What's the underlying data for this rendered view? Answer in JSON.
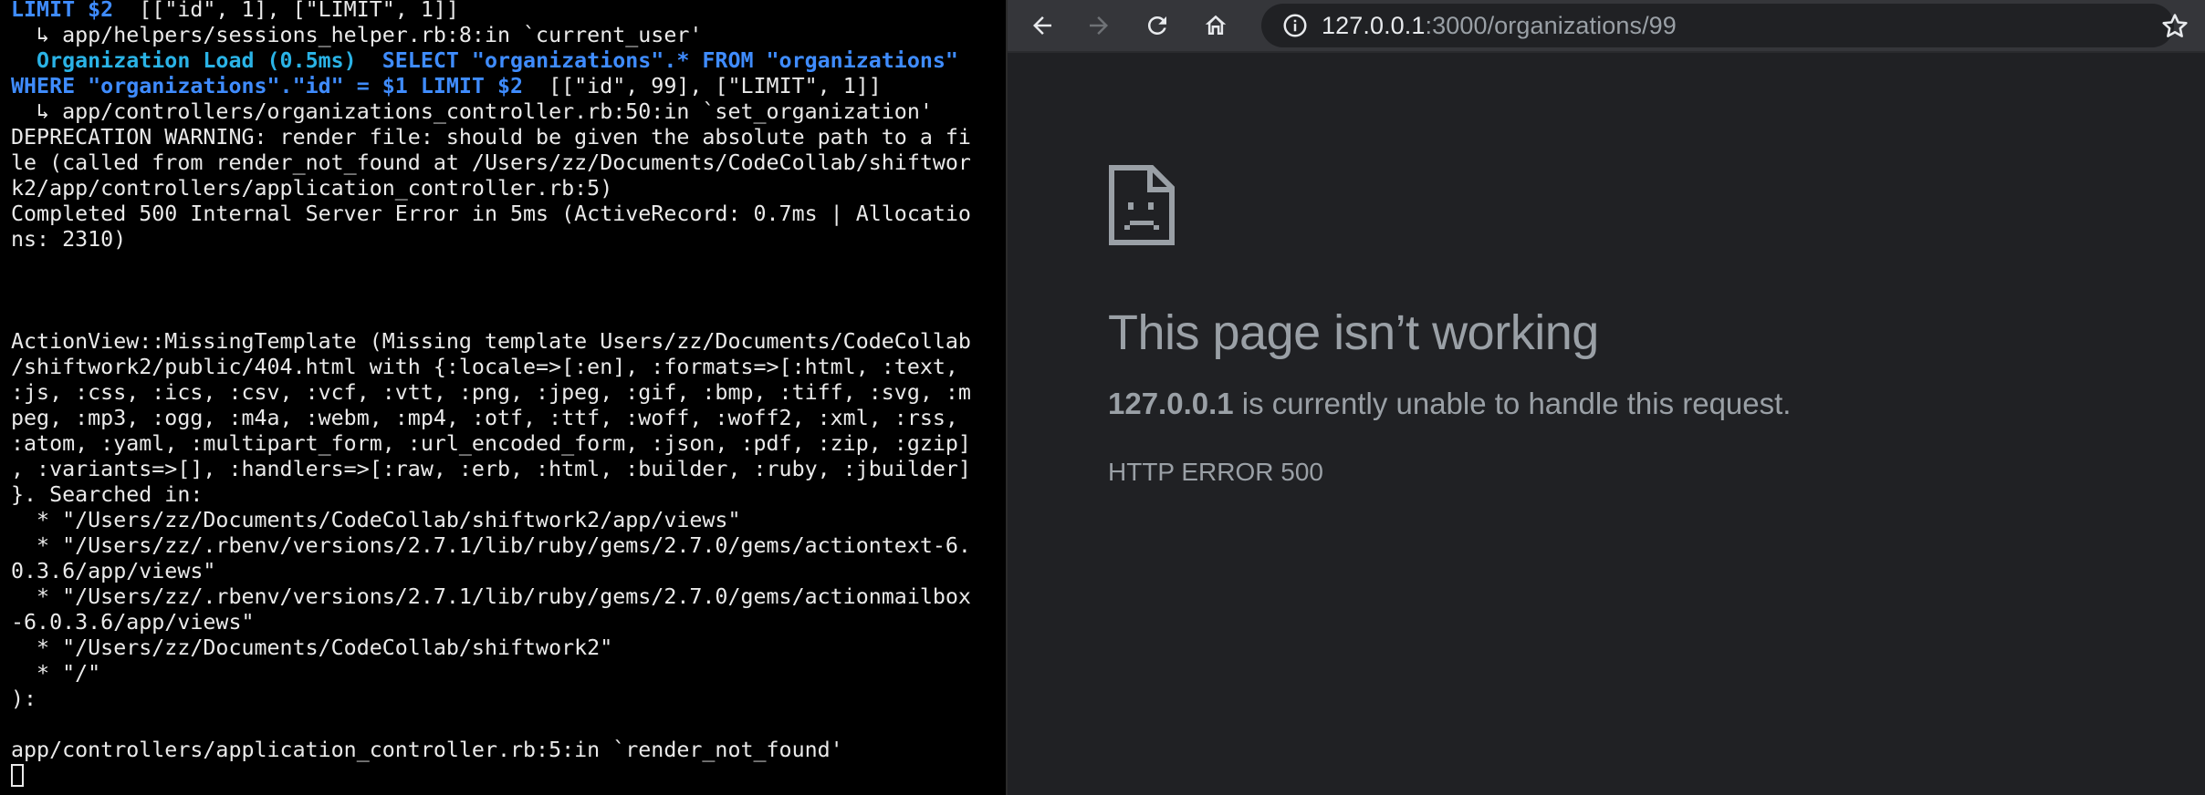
{
  "terminal": {
    "lines": [
      {
        "segments": [
          {
            "text": "LIMIT $2",
            "style": "blue"
          },
          {
            "text": "  [[\"id\", 1], [\"LIMIT\", 1]]",
            "style": "plain"
          }
        ]
      },
      {
        "segments": [
          {
            "text": "  ↳ app/helpers/sessions_helper.rb:8:in `current_user'",
            "style": "plain"
          }
        ]
      },
      {
        "segments": [
          {
            "text": "  Organization Load (0.5ms)",
            "style": "cyan"
          },
          {
            "text": "  SELECT \"organizations\".* FROM \"organizations\"",
            "style": "blue"
          }
        ]
      },
      {
        "segments": [
          {
            "text": "WHERE \"organizations\".\"id\" = $1 LIMIT $2",
            "style": "blue"
          },
          {
            "text": "  [[\"id\", 99], [\"LIMIT\", 1]]",
            "style": "plain"
          }
        ]
      },
      {
        "segments": [
          {
            "text": "  ↳ app/controllers/organizations_controller.rb:50:in `set_organization'",
            "style": "plain"
          }
        ]
      },
      {
        "segments": [
          {
            "text": "DEPRECATION WARNING: render file: should be given the absolute path to a fi",
            "style": "plain"
          }
        ]
      },
      {
        "segments": [
          {
            "text": "le (called from render_not_found at /Users/zz/Documents/CodeCollab/shiftwor",
            "style": "plain"
          }
        ]
      },
      {
        "segments": [
          {
            "text": "k2/app/controllers/application_controller.rb:5)",
            "style": "plain"
          }
        ]
      },
      {
        "segments": [
          {
            "text": "Completed 500 Internal Server Error in 5ms (ActiveRecord: 0.7ms | Allocatio",
            "style": "plain"
          }
        ]
      },
      {
        "segments": [
          {
            "text": "ns: 2310)",
            "style": "plain"
          }
        ]
      },
      {
        "segments": [
          {
            "text": "",
            "style": "plain"
          }
        ]
      },
      {
        "segments": [
          {
            "text": "",
            "style": "plain"
          }
        ]
      },
      {
        "segments": [
          {
            "text": "",
            "style": "plain"
          }
        ]
      },
      {
        "segments": [
          {
            "text": "ActionView::MissingTemplate (Missing template Users/zz/Documents/CodeCollab",
            "style": "plain"
          }
        ]
      },
      {
        "segments": [
          {
            "text": "/shiftwork2/public/404.html with {:locale=>[:en], :formats=>[:html, :text,",
            "style": "plain"
          }
        ]
      },
      {
        "segments": [
          {
            "text": ":js, :css, :ics, :csv, :vcf, :vtt, :png, :jpeg, :gif, :bmp, :tiff, :svg, :m",
            "style": "plain"
          }
        ]
      },
      {
        "segments": [
          {
            "text": "peg, :mp3, :ogg, :m4a, :webm, :mp4, :otf, :ttf, :woff, :woff2, :xml, :rss,",
            "style": "plain"
          }
        ]
      },
      {
        "segments": [
          {
            "text": ":atom, :yaml, :multipart_form, :url_encoded_form, :json, :pdf, :zip, :gzip]",
            "style": "plain"
          }
        ]
      },
      {
        "segments": [
          {
            "text": ", :variants=>[], :handlers=>[:raw, :erb, :html, :builder, :ruby, :jbuilder]",
            "style": "plain"
          }
        ]
      },
      {
        "segments": [
          {
            "text": "}. Searched in:",
            "style": "plain"
          }
        ]
      },
      {
        "segments": [
          {
            "text": "  * \"/Users/zz/Documents/CodeCollab/shiftwork2/app/views\"",
            "style": "plain"
          }
        ]
      },
      {
        "segments": [
          {
            "text": "  * \"/Users/zz/.rbenv/versions/2.7.1/lib/ruby/gems/2.7.0/gems/actiontext-6.",
            "style": "plain"
          }
        ]
      },
      {
        "segments": [
          {
            "text": "0.3.6/app/views\"",
            "style": "plain"
          }
        ]
      },
      {
        "segments": [
          {
            "text": "  * \"/Users/zz/.rbenv/versions/2.7.1/lib/ruby/gems/2.7.0/gems/actionmailbox",
            "style": "plain"
          }
        ]
      },
      {
        "segments": [
          {
            "text": "-6.0.3.6/app/views\"",
            "style": "plain"
          }
        ]
      },
      {
        "segments": [
          {
            "text": "  * \"/Users/zz/Documents/CodeCollab/shiftwork2\"",
            "style": "plain"
          }
        ]
      },
      {
        "segments": [
          {
            "text": "  * \"/\"",
            "style": "plain"
          }
        ]
      },
      {
        "segments": [
          {
            "text": "):",
            "style": "plain"
          }
        ]
      },
      {
        "segments": [
          {
            "text": "",
            "style": "plain"
          }
        ]
      },
      {
        "segments": [
          {
            "text": "app/controllers/application_controller.rb:5:in `render_not_found'",
            "style": "plain"
          }
        ]
      }
    ],
    "cursor_icon": "block-cursor-icon"
  },
  "browser": {
    "toolbar": {
      "back_icon": "arrow-left-icon",
      "forward_icon": "arrow-right-icon",
      "reload_icon": "reload-icon",
      "home_icon": "home-icon",
      "info_icon": "info-circle-icon",
      "url_host": "127.0.0.1",
      "url_rest": ":3000/organizations/99",
      "bookmark_icon": "star-icon"
    },
    "error_page": {
      "icon": "sad-page-icon",
      "title": "This page isn’t working",
      "message_host": "127.0.0.1",
      "message_rest": " is currently unable to handle this request.",
      "error_code": "HTTP ERROR 500"
    },
    "colors": {
      "background": "#202124",
      "toolbar": "#35363a",
      "text_muted": "#9aa0a6",
      "text_bright": "#e8eaed"
    }
  }
}
